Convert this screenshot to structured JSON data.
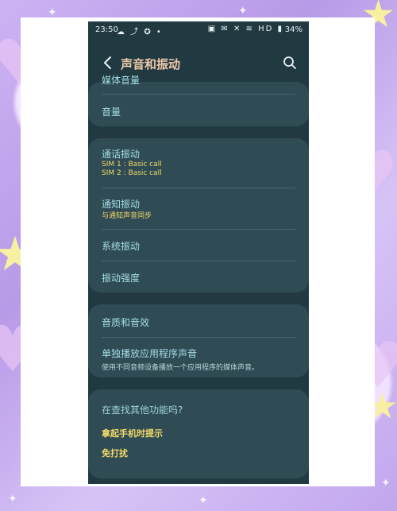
{
  "status_bar": {
    "time": "23:50",
    "left_icons": "☁ ⤴ ✪ •",
    "right_icons": "▣ ✉ ✕ ≋ HD ▮",
    "battery": "34%"
  },
  "header": {
    "title": "声音和振动"
  },
  "group1": {
    "partial_item": "媒体音量",
    "volume": "音量"
  },
  "group2": {
    "call_vibration": "通话振动",
    "call_sim1": "SIM 1 : Basic call",
    "call_sim2": "SIM 2 : Basic call",
    "notify_vibration": "通知振动",
    "notify_sub": "与通知声音同步",
    "system_vibration": "系统振动",
    "vibration_intensity": "振动强度"
  },
  "group3": {
    "sound_quality": "音质和音效",
    "separate_app_sound": "单独播放应用程序声音",
    "separate_app_sub": "使用不同音频设备播放一个应用程序的媒体声音。"
  },
  "group4": {
    "looking_for": "在查找其他功能吗?",
    "lift_to_alert": "拿起手机时提示",
    "do_not_disturb": "免打扰"
  },
  "colors": {
    "screen_bg": "#213a42",
    "card_bg": "#2f4b54",
    "title": "#f0c9a8",
    "item_label": "#a6dde6",
    "accent_yellow": "#f3d96a"
  }
}
